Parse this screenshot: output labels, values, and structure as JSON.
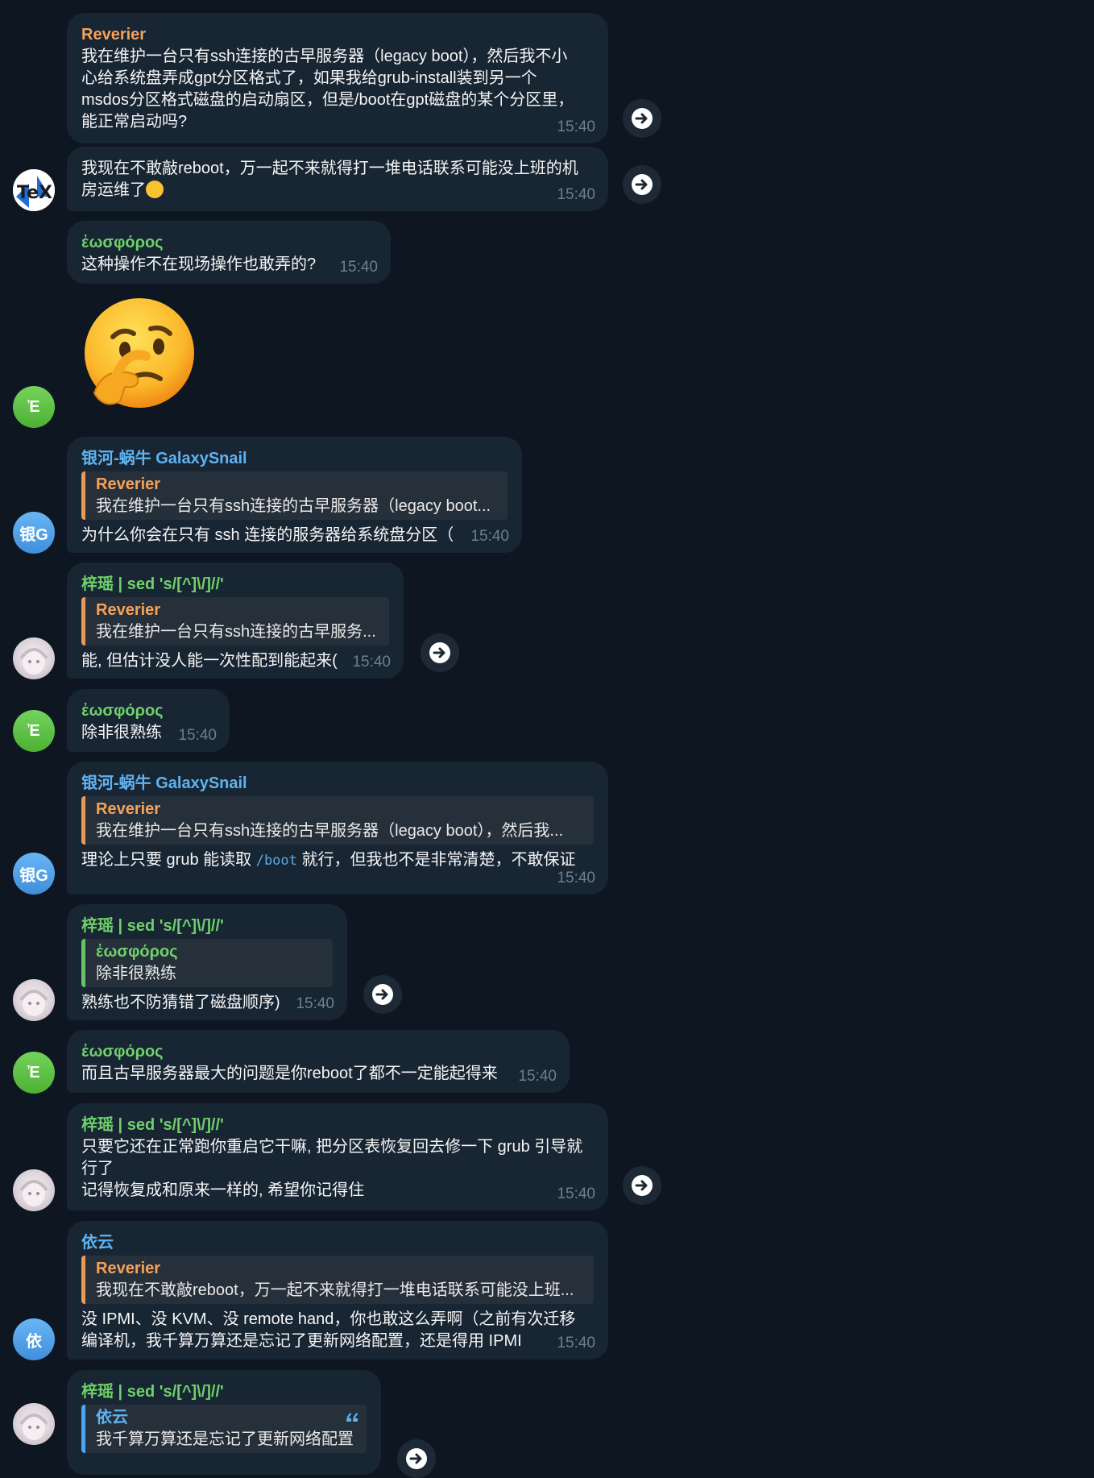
{
  "messages": [
    {
      "sender": "Reverier",
      "text": "我在维护一台只有ssh连接的古早服务器（legacy boot），然后我不小心给系统盘弄成gpt分区格式了，如果我给grub-install装到另一个msdos分区格式磁盘的启动扇区，但是/boot在gpt磁盘的某个分区里，能正常启动吗?",
      "time": "15:40"
    },
    {
      "text": "我现在不敢敲reboot，万一起不来就得打一堆电话联系可能没上班的机房运维了",
      "time": "15:40"
    },
    {
      "sender": "ἐωσφόρος",
      "text": "这种操作不在现场操作也敢弄的?",
      "time": "15:40"
    },
    {
      "sticker": "thinking-face"
    },
    {
      "sender": "银河-蜗牛 GalaxySnail",
      "quote_name": "Reverier",
      "quote_text": "我在维护一台只有ssh连接的古早服务器（legacy boot...",
      "text": "为什么你会在只有 ssh 连接的服务器给系统盘分区（",
      "time": "15:40"
    },
    {
      "sender": "梓瑶 | sed 's/[^]\\/]//'",
      "quote_name": "Reverier",
      "quote_text": "我在维护一台只有ssh连接的古早服务...",
      "text": "能, 但估计没人能一次性配到能起来(",
      "time": "15:40"
    },
    {
      "sender": "ἐωσφόρος",
      "text": "除非很熟练",
      "time": "15:40"
    },
    {
      "sender": "银河-蜗牛 GalaxySnail",
      "quote_name": "Reverier",
      "quote_text": "我在维护一台只有ssh连接的古早服务器（legacy boot），然后我...",
      "text_before": "理论上只要 grub 能读取 ",
      "code": "/boot",
      "text_after": " 就行，但我也不是非常清楚，不敢保证",
      "time": "15:40"
    },
    {
      "sender": "梓瑶 | sed 's/[^]\\/]//'",
      "quote_name": "ἐωσφόρος",
      "quote_text": "除非很熟练",
      "text": "熟练也不防猜错了磁盘顺序)",
      "time": "15:40"
    },
    {
      "sender": "ἐωσφόρος",
      "text": "而且古早服务器最大的问题是你reboot了都不一定能起得来",
      "time": "15:40"
    },
    {
      "sender": "梓瑶 | sed 's/[^]\\/]//'",
      "text_line1": "只要它还在正常跑你重启它干嘛, 把分区表恢复回去修一下 grub 引导就行了",
      "text_line2": "记得恢复成和原来一样的, 希望你记得住",
      "time": "15:40"
    },
    {
      "sender": "依云",
      "quote_name": "Reverier",
      "quote_text": "我现在不敢敲reboot，万一起不来就得打一堆电话联系可能没上班...",
      "text": "没 IPMI、没 KVM、没 remote hand，你也敢这么弄啊（之前有次迁移编译机，我千算万算还是忘记了更新网络配置，还是得用 IPMI",
      "time": "15:40"
    },
    {
      "sender": "梓瑶 | sed 's/[^]\\/]//'",
      "quote_name": "依云",
      "quote_text": "我千算万算还是忘记了更新网络配置"
    }
  ],
  "avatars": {
    "epsilon": "Ἐ",
    "galaxy": "银G",
    "yiyun": "依"
  },
  "colors": {
    "background": "#0e1621",
    "bubble": "#182533",
    "orange": "#f4a25a",
    "green": "#6fd16a",
    "blue": "#5fb3f0"
  }
}
